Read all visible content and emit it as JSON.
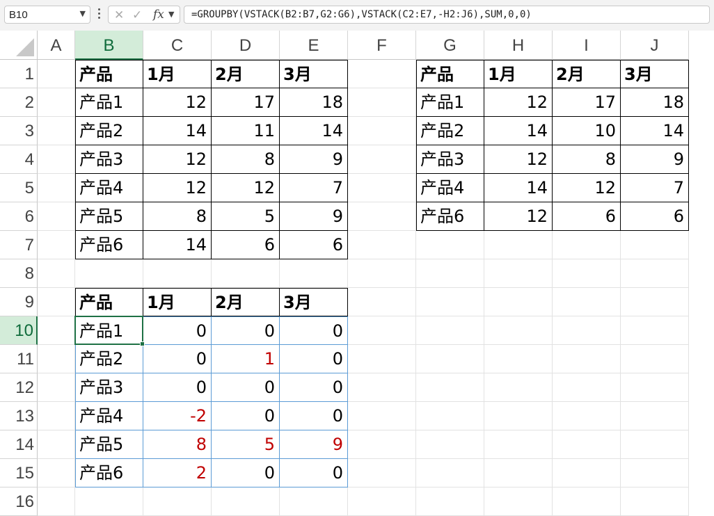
{
  "formula_bar": {
    "name_box": "B10",
    "fx_label": "fx",
    "formula": "=GROUPBY(VSTACK(B2:B7,G2:G6),VSTACK(C2:E7,-H2:J6),SUM,0,0)",
    "cancel_icon": "x-icon",
    "enter_icon": "checkmark-icon"
  },
  "columns": [
    "A",
    "B",
    "C",
    "D",
    "E",
    "F",
    "G",
    "H",
    "I",
    "J"
  ],
  "rows": [
    "1",
    "2",
    "3",
    "4",
    "5",
    "6",
    "7",
    "8",
    "9",
    "10",
    "11",
    "12",
    "13",
    "14",
    "15",
    "16"
  ],
  "selected": {
    "column": "B",
    "row": "10"
  },
  "cells": [
    {
      "ref": "B1",
      "v": "产品",
      "bold": true
    },
    {
      "ref": "C1",
      "v": "1月",
      "bold": true
    },
    {
      "ref": "D1",
      "v": "2月",
      "bold": true
    },
    {
      "ref": "E1",
      "v": "3月",
      "bold": true
    },
    {
      "ref": "B2",
      "v": "产品1"
    },
    {
      "ref": "C2",
      "v": "12"
    },
    {
      "ref": "D2",
      "v": "17"
    },
    {
      "ref": "E2",
      "v": "18"
    },
    {
      "ref": "B3",
      "v": "产品2"
    },
    {
      "ref": "C3",
      "v": "14"
    },
    {
      "ref": "D3",
      "v": "11"
    },
    {
      "ref": "E3",
      "v": "14"
    },
    {
      "ref": "B4",
      "v": "产品3"
    },
    {
      "ref": "C4",
      "v": "12"
    },
    {
      "ref": "D4",
      "v": "8"
    },
    {
      "ref": "E4",
      "v": "9"
    },
    {
      "ref": "B5",
      "v": "产品4"
    },
    {
      "ref": "C5",
      "v": "12"
    },
    {
      "ref": "D5",
      "v": "12"
    },
    {
      "ref": "E5",
      "v": "7"
    },
    {
      "ref": "B6",
      "v": "产品5"
    },
    {
      "ref": "C6",
      "v": "8"
    },
    {
      "ref": "D6",
      "v": "5"
    },
    {
      "ref": "E6",
      "v": "9"
    },
    {
      "ref": "B7",
      "v": "产品6"
    },
    {
      "ref": "C7",
      "v": "14"
    },
    {
      "ref": "D7",
      "v": "6"
    },
    {
      "ref": "E7",
      "v": "6"
    },
    {
      "ref": "G1",
      "v": "产品",
      "bold": true
    },
    {
      "ref": "H1",
      "v": "1月",
      "bold": true
    },
    {
      "ref": "I1",
      "v": "2月",
      "bold": true
    },
    {
      "ref": "J1",
      "v": "3月",
      "bold": true
    },
    {
      "ref": "G2",
      "v": "产品1"
    },
    {
      "ref": "H2",
      "v": "12"
    },
    {
      "ref": "I2",
      "v": "17"
    },
    {
      "ref": "J2",
      "v": "18"
    },
    {
      "ref": "G3",
      "v": "产品2"
    },
    {
      "ref": "H3",
      "v": "14"
    },
    {
      "ref": "I3",
      "v": "10"
    },
    {
      "ref": "J3",
      "v": "14"
    },
    {
      "ref": "G4",
      "v": "产品3"
    },
    {
      "ref": "H4",
      "v": "12"
    },
    {
      "ref": "I4",
      "v": "8"
    },
    {
      "ref": "J4",
      "v": "9"
    },
    {
      "ref": "G5",
      "v": "产品4"
    },
    {
      "ref": "H5",
      "v": "14"
    },
    {
      "ref": "I5",
      "v": "12"
    },
    {
      "ref": "J5",
      "v": "7"
    },
    {
      "ref": "G6",
      "v": "产品6"
    },
    {
      "ref": "H6",
      "v": "12"
    },
    {
      "ref": "I6",
      "v": "6"
    },
    {
      "ref": "J6",
      "v": "6"
    },
    {
      "ref": "B9",
      "v": "产品",
      "bold": true
    },
    {
      "ref": "C9",
      "v": "1月",
      "bold": true
    },
    {
      "ref": "D9",
      "v": "2月",
      "bold": true
    },
    {
      "ref": "E9",
      "v": "3月",
      "bold": true
    },
    {
      "ref": "B10",
      "v": "产品1"
    },
    {
      "ref": "C10",
      "v": "0"
    },
    {
      "ref": "D10",
      "v": "0"
    },
    {
      "ref": "E10",
      "v": "0"
    },
    {
      "ref": "B11",
      "v": "产品2"
    },
    {
      "ref": "C11",
      "v": "0"
    },
    {
      "ref": "D11",
      "v": "1",
      "red": true
    },
    {
      "ref": "E11",
      "v": "0"
    },
    {
      "ref": "B12",
      "v": "产品3"
    },
    {
      "ref": "C12",
      "v": "0"
    },
    {
      "ref": "D12",
      "v": "0"
    },
    {
      "ref": "E12",
      "v": "0"
    },
    {
      "ref": "B13",
      "v": "产品4"
    },
    {
      "ref": "C13",
      "v": "-2",
      "red": true
    },
    {
      "ref": "D13",
      "v": "0"
    },
    {
      "ref": "E13",
      "v": "0"
    },
    {
      "ref": "B14",
      "v": "产品5"
    },
    {
      "ref": "C14",
      "v": "8",
      "red": true
    },
    {
      "ref": "D14",
      "v": "5",
      "red": true
    },
    {
      "ref": "E14",
      "v": "9",
      "red": true
    },
    {
      "ref": "B15",
      "v": "产品6"
    },
    {
      "ref": "C15",
      "v": "2",
      "red": true
    },
    {
      "ref": "D15",
      "v": "0"
    },
    {
      "ref": "E15",
      "v": "0"
    }
  ]
}
